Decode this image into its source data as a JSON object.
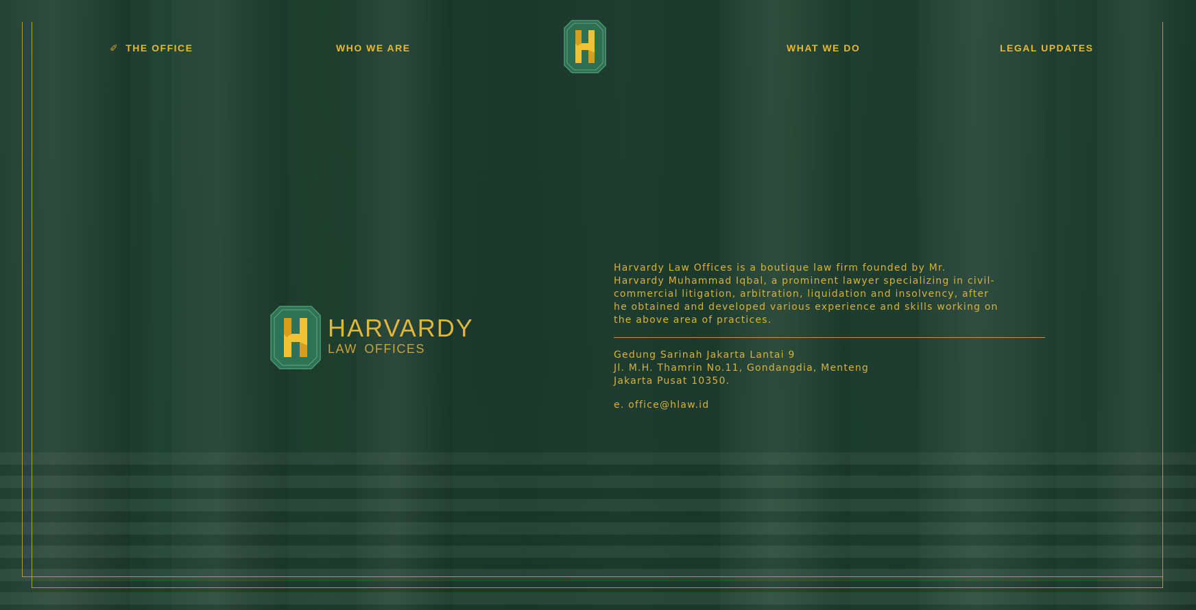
{
  "nav": {
    "office_label": "THE OFFICE",
    "who_label": "WHO WE ARE",
    "what_label": "WHAT WE DO",
    "legal_label": "LEGAL UPDATES"
  },
  "brand": {
    "name": "HARVARDY",
    "subtitle": "LAW OFFICES"
  },
  "about": {
    "line1": "Harvardy Law Offices is a boutique law firm founded by Mr.",
    "line2": "Harvardy Muhammad Iqbal, a prominent lawyer specializing in civil-",
    "line3": "commercial litigation, arbitration, liquidation and insolvency, after",
    "line4": "he obtained and developed various experience and skills working on",
    "line5": "the above area of practices."
  },
  "contact": {
    "address_line1": "Gedung Sarinah Jakarta Lantai 9",
    "address_line2": "Jl. M.H. Thamrin No.11, Gondangdia, Menteng",
    "address_line3": "Jakarta Pusat 10350.",
    "email_prefix": "e.",
    "email": "office@hlaw.id"
  },
  "icons": {
    "office_nav": "pen-icon",
    "logo": "harvardy-h-emblem"
  },
  "colors": {
    "background": "#1c3a2d",
    "gold": "#e2b63a",
    "frame": "#b59a3b",
    "emblem_green": "#2f7a5a"
  }
}
